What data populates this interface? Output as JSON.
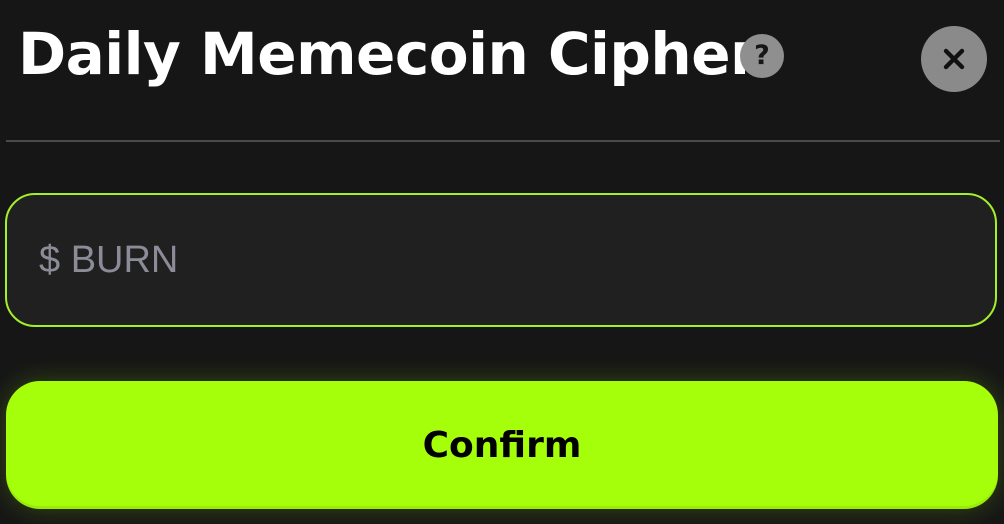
{
  "dialog": {
    "title": "Daily Memecoin Cipher",
    "help_icon_glyph": "?",
    "help_icon": "question-mark-icon",
    "close_icon": "close-x-icon"
  },
  "cipher_input": {
    "placeholder": "$ BURN",
    "value": ""
  },
  "confirm_button": {
    "label": "Confirm"
  },
  "colors": {
    "background": "#161616",
    "accent": "#a6ff0a",
    "input_border": "#a3f02a",
    "input_background": "#202020",
    "placeholder": "#8c8c98",
    "icon_grey": "#8a8a8a"
  }
}
